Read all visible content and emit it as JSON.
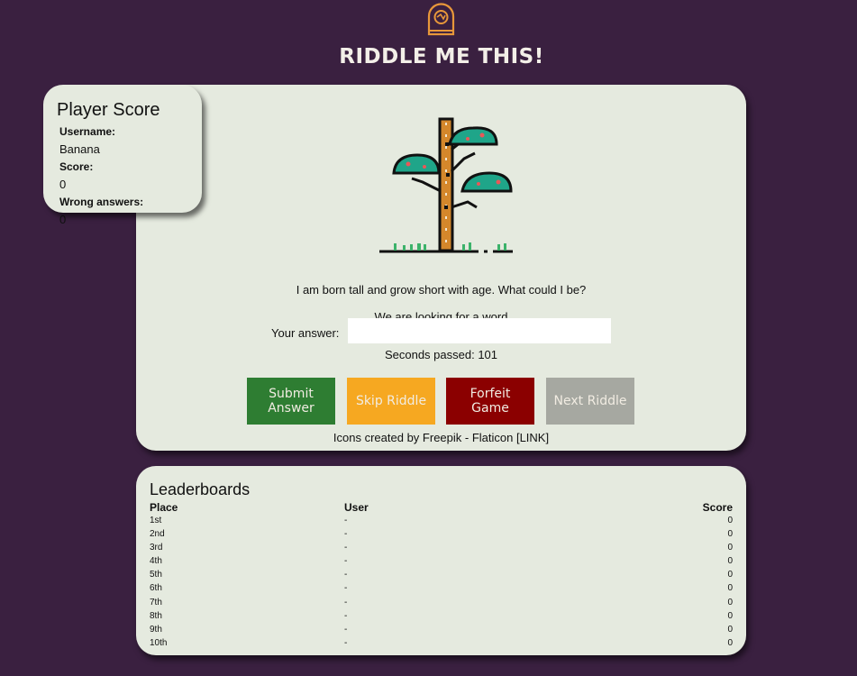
{
  "header": {
    "title": "RIDDLE ME THIS!",
    "logo_icon": "brain-door-icon",
    "logo_color": "#e8973a"
  },
  "player": {
    "heading": "Player Score",
    "username_label": "Username:",
    "username": "Banana",
    "score_label": "Score:",
    "score": "0",
    "wrong_label": "Wrong answers:",
    "wrong": "0"
  },
  "riddle": {
    "image_icon": "tree-icon",
    "question": "I am born tall and grow short with age. What could I be?",
    "hint": "We are looking for a word",
    "answer_label": "Your answer:",
    "answer_value": "",
    "seconds_text": "Seconds passed: 101",
    "credit": "Icons created by Freepik - Flaticon [LINK]"
  },
  "buttons": {
    "submit": "Submit Answer",
    "skip": "Skip Riddle",
    "forfeit": "Forfeit Game",
    "next": "Next Riddle"
  },
  "colors": {
    "background": "#3a2040",
    "card": "#e5eadf",
    "submit": "#2e7d32",
    "skip": "#f6a821",
    "forfeit": "#8b0000",
    "next": "#a6a8a1"
  },
  "leaderboard": {
    "title": "Leaderboards",
    "headers": {
      "place": "Place",
      "user": "User",
      "score": "Score"
    },
    "rows": [
      {
        "place": "1st",
        "user": "-",
        "score": "0"
      },
      {
        "place": "2nd",
        "user": "-",
        "score": "0"
      },
      {
        "place": "3rd",
        "user": "-",
        "score": "0"
      },
      {
        "place": "4th",
        "user": "-",
        "score": "0"
      },
      {
        "place": "5th",
        "user": "-",
        "score": "0"
      },
      {
        "place": "6th",
        "user": "-",
        "score": "0"
      },
      {
        "place": "7th",
        "user": "-",
        "score": "0"
      },
      {
        "place": "8th",
        "user": "-",
        "score": "0"
      },
      {
        "place": "9th",
        "user": "-",
        "score": "0"
      },
      {
        "place": "10th",
        "user": "-",
        "score": "0"
      }
    ]
  }
}
